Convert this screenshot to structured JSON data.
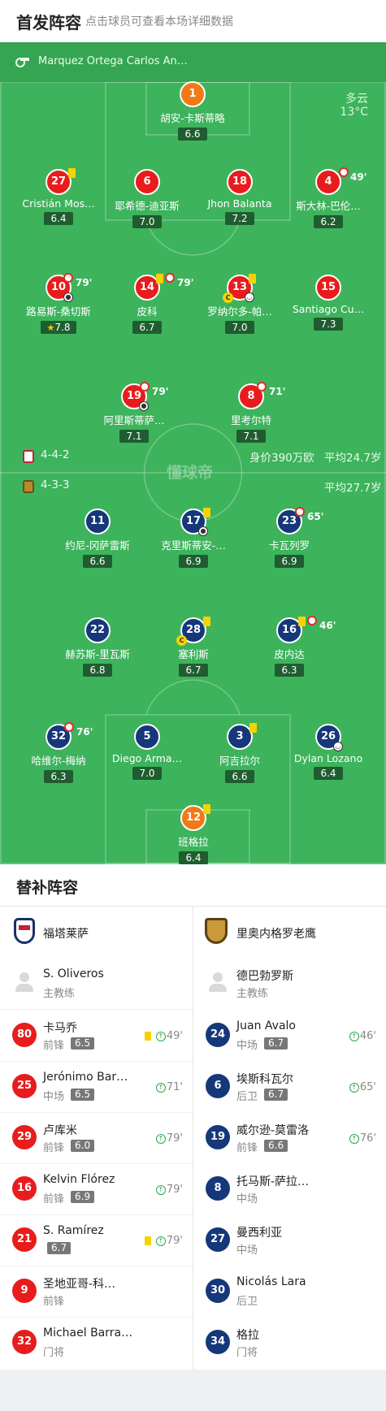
{
  "header": {
    "title": "首发阵容",
    "subtitle": "点击球员可查看本场详细数据"
  },
  "referee": {
    "name": "Marquez Ortega Carlos An…"
  },
  "weather": {
    "condition": "多云",
    "temperature": "13°C"
  },
  "watermark": "懂球帝",
  "home_team": {
    "formation": "4-4-2",
    "value": "身价390万欧",
    "avg_age": "平均24.7岁",
    "players": [
      {
        "num": "1",
        "name": "胡安-卡斯蒂略",
        "rating": "6.6"
      },
      {
        "num": "27",
        "name": "Cristián Mos…",
        "rating": "6.4"
      },
      {
        "num": "6",
        "name": "耶希德-迪亚斯",
        "rating": "7.0"
      },
      {
        "num": "18",
        "name": "Jhon Balanta",
        "rating": "7.2"
      },
      {
        "num": "4",
        "name": "斯大林-巴伦…",
        "rating": "6.2",
        "sub": "49'"
      },
      {
        "num": "10",
        "name": "路易斯-桑切斯",
        "rating": "7.8",
        "sub": "79'"
      },
      {
        "num": "14",
        "name": "皮科",
        "rating": "6.7",
        "sub": "79'"
      },
      {
        "num": "13",
        "name": "罗纳尔多-帕…",
        "rating": "7.0"
      },
      {
        "num": "15",
        "name": "Santiago Cu…",
        "rating": "7.3"
      },
      {
        "num": "19",
        "name": "阿里斯蒂萨…",
        "rating": "7.1",
        "sub": "79'"
      },
      {
        "num": "8",
        "name": "里考尔特",
        "rating": "7.1",
        "sub": "71'"
      }
    ]
  },
  "away_team": {
    "formation": "4-3-3",
    "avg_age": "平均27.7岁",
    "players": [
      {
        "num": "11",
        "name": "约尼-冈萨雷斯",
        "rating": "6.6"
      },
      {
        "num": "17",
        "name": "克里斯蒂安-…",
        "rating": "6.9"
      },
      {
        "num": "23",
        "name": "卡瓦列罗",
        "rating": "6.9",
        "sub": "65'"
      },
      {
        "num": "22",
        "name": "赫苏斯-里瓦斯",
        "rating": "6.8"
      },
      {
        "num": "28",
        "name": "塞利斯",
        "rating": "6.7"
      },
      {
        "num": "16",
        "name": "皮内达",
        "rating": "6.3",
        "sub": "46'"
      },
      {
        "num": "32",
        "name": "哈维尔-梅纳",
        "rating": "6.3",
        "sub": "76'"
      },
      {
        "num": "5",
        "name": "Diego Arma…",
        "rating": "7.0"
      },
      {
        "num": "3",
        "name": "阿吉拉尔",
        "rating": "6.6"
      },
      {
        "num": "26",
        "name": "Dylan Lozano",
        "rating": "6.4"
      },
      {
        "num": "12",
        "name": "班格拉",
        "rating": "6.4"
      }
    ]
  },
  "subs": {
    "title": "替补阵容",
    "home": {
      "team_name": "福塔莱萨",
      "coach": {
        "name": "S. Oliveros",
        "role": "主教练"
      },
      "players": [
        {
          "num": "80",
          "name": "卡马乔",
          "pos": "前锋",
          "rating": "6.5",
          "time": "49'"
        },
        {
          "num": "25",
          "name": "Jerónimo Bar…",
          "pos": "中场",
          "rating": "6.5",
          "time": "71'"
        },
        {
          "num": "29",
          "name": "卢库米",
          "pos": "前锋",
          "rating": "6.0",
          "time": "79'"
        },
        {
          "num": "16",
          "name": "Kelvin Flórez",
          "pos": "前锋",
          "rating": "6.9",
          "time": "79'"
        },
        {
          "num": "21",
          "name": "S. Ramírez",
          "pos": "",
          "rating": "6.7",
          "time": "79'"
        },
        {
          "num": "9",
          "name": "圣地亚哥-科…",
          "pos": "前锋",
          "rating": "",
          "time": ""
        },
        {
          "num": "32",
          "name": "Michael Barra…",
          "pos": "门将",
          "rating": "",
          "time": ""
        }
      ]
    },
    "away": {
      "team_name": "里奥内格罗老鹰",
      "coach": {
        "name": "德巴勃罗斯",
        "role": "主教练"
      },
      "players": [
        {
          "num": "24",
          "name": "Juan Avalo",
          "pos": "中场",
          "rating": "6.7",
          "time": "46'"
        },
        {
          "num": "6",
          "name": "埃斯科瓦尔",
          "pos": "后卫",
          "rating": "6.7",
          "time": "65'"
        },
        {
          "num": "19",
          "name": "威尔逊-莫雷洛",
          "pos": "前锋",
          "rating": "6.6",
          "time": "76'"
        },
        {
          "num": "8",
          "name": "托马斯-萨拉…",
          "pos": "中场",
          "rating": "",
          "time": ""
        },
        {
          "num": "27",
          "name": "曼西利亚",
          "pos": "中场",
          "rating": "",
          "time": ""
        },
        {
          "num": "30",
          "name": "Nicolás Lara",
          "pos": "后卫",
          "rating": "",
          "time": ""
        },
        {
          "num": "34",
          "name": "格拉",
          "pos": "门将",
          "rating": "",
          "time": ""
        }
      ]
    }
  },
  "colors": {
    "pitch": "#3db35c",
    "home": "#e81c1c",
    "away": "#16377a",
    "gk": "#f07a16"
  }
}
